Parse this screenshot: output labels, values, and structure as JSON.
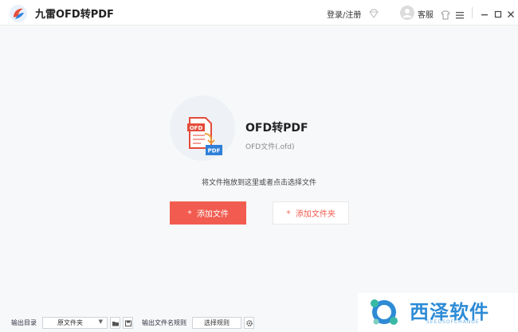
{
  "titlebar": {
    "app_title": "九雷OFD转PDF",
    "login_label": "登录/注册",
    "service_label": "客服",
    "icons": [
      "logo-icon",
      "vip-diamond-icon",
      "avatar-icon",
      "skin-shirt-icon",
      "menu-icon",
      "minimize-icon",
      "maximize-icon",
      "close-icon"
    ]
  },
  "hero": {
    "title": "OFD转PDF",
    "subtitle": "OFD文件(.ofd)",
    "icon_badge_top": "OFD",
    "icon_badge_bottom": "PDF",
    "hint": "将文件拖放到这里或者点击选择文件"
  },
  "actions": {
    "plus_glyph": "+",
    "add_file": "添加文件",
    "add_folder": "添加文件夹"
  },
  "bottom": {
    "output_dir_label": "输出目录",
    "output_dir_value": "原文件夹",
    "naming_label": "输出文件名规则",
    "choose_rule": "选择规则"
  },
  "watermark": {
    "text": "西泽软件",
    "sub": "SEEDSOFCHANGE"
  },
  "colors": {
    "accent": "#f25c50",
    "brand_blue": "#2d8bd6",
    "background": "#f7f8fa"
  }
}
